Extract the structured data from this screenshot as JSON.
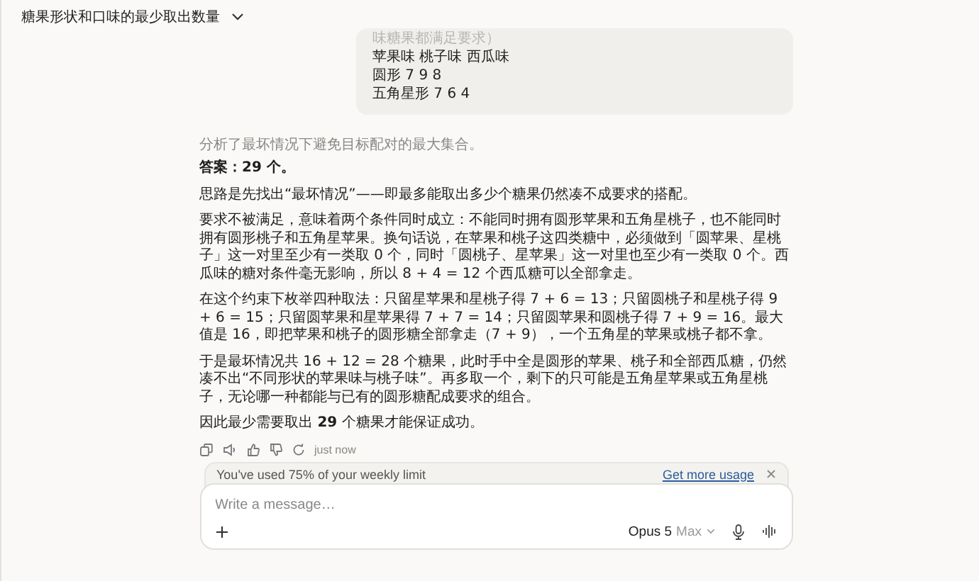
{
  "header": {
    "title": "糖果形状和口味的最少取出数量"
  },
  "user_message": {
    "lines": [
      {
        "text": "味糖果都满足要求）",
        "faded": true
      },
      {
        "text": "苹果味 桃子味 西瓜味",
        "faded": false
      },
      {
        "text": "圆形 7 9 8",
        "faded": false
      },
      {
        "text": "五角星形 7 6 4",
        "faded": false
      }
    ]
  },
  "response": {
    "thinking_summary": "分析了最坏情况下避免目标配对的最大集合。",
    "paragraphs": [
      {
        "kind": "answer",
        "text": "答案：29 个。"
      },
      {
        "kind": "text",
        "text": "思路是先找出“最坏情况”——即最多能取出多少个糖果仍然凑不成要求的搭配。"
      },
      {
        "kind": "text",
        "text": "要求不被满足，意味着两个条件同时成立：不能同时拥有圆形苹果和五角星桃子，也不能同时拥有圆形桃子和五角星苹果。换句话说，在苹果和桃子这四类糖中，必须做到「圆苹果、星桃子」这一对里至少有一类取 0 个，同时「圆桃子、星苹果」这一对里也至少有一类取 0 个。西瓜味的糖对条件毫无影响，所以 8 + 4 = 12 个西瓜糖可以全部拿走。"
      },
      {
        "kind": "text",
        "text": "在这个约束下枚举四种取法：只留星苹果和星桃子得 7 + 6 = 13；只留圆桃子和星桃子得 9 + 6 = 15；只留圆苹果和星苹果得 7 + 7 = 14；只留圆苹果和圆桃子得 7 + 9 = 16。最大值是 16，即把苹果和桃子的圆形糖全部拿走（7 + 9），一个五角星的苹果或桃子都不拿。"
      },
      {
        "kind": "text",
        "text": "于是最坏情况共 16 + 12 = 28 个糖果，此时手中全是圆形的苹果、桃子和全部西瓜糖，仍然凑不出“不同形状的苹果味与桃子味”。再多取一个，剩下的只可能是五角星苹果或五角星桃子，无论哪一种都能与已有的圆形糖配成要求的组合。"
      },
      {
        "kind": "text",
        "text": "因此最少需要取出 **29** 个糖果才能保证成功。"
      }
    ],
    "timestamp": "just now"
  },
  "usage_banner": {
    "text": "You've used 75% of your weekly limit",
    "link": "Get more usage"
  },
  "composer": {
    "placeholder": "Write a message…",
    "model": "Opus 5",
    "effort": "Max"
  }
}
